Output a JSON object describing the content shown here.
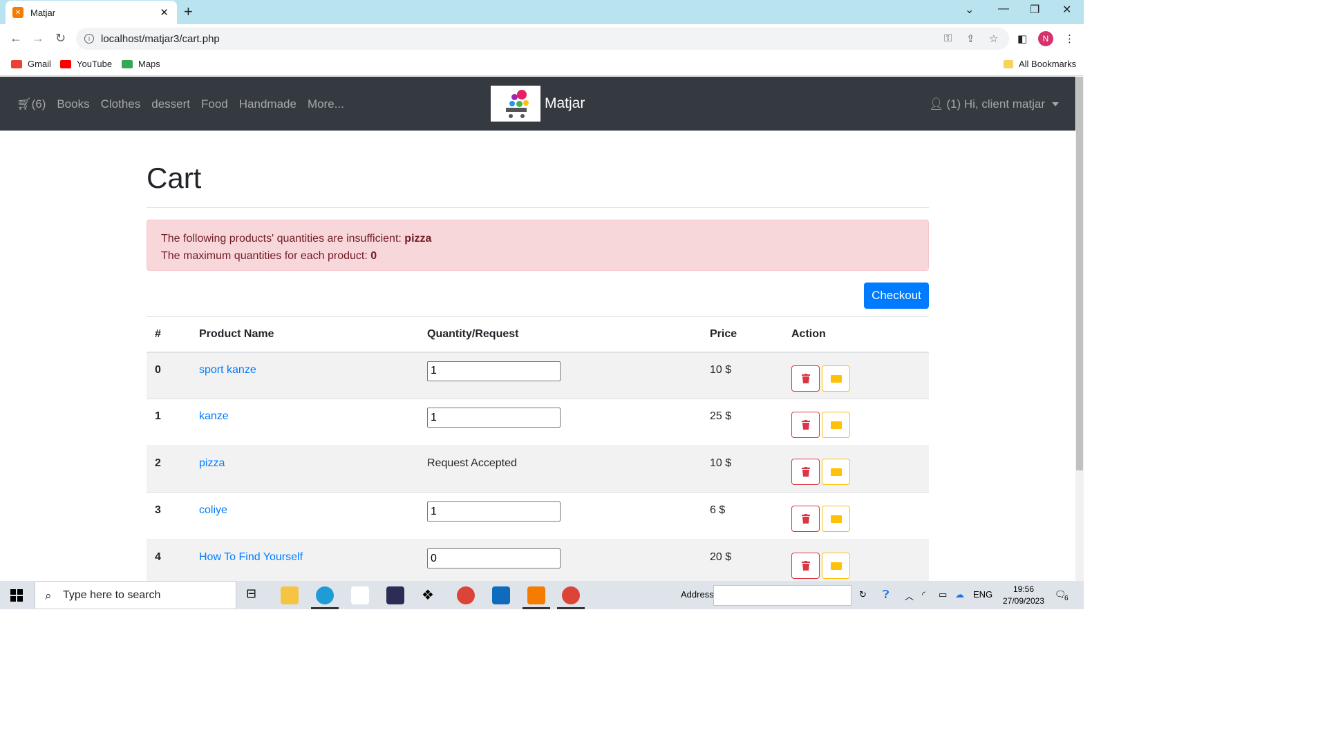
{
  "browser": {
    "tab_title": "Matjar",
    "url": "localhost/matjar3/cart.php",
    "profile_initial": "N",
    "bookmarks": [
      {
        "label": "Gmail",
        "color": "#ea4335"
      },
      {
        "label": "YouTube",
        "color": "#ff0000"
      },
      {
        "label": "Maps",
        "color": "#34a853"
      }
    ],
    "all_bookmarks": "All Bookmarks"
  },
  "navbar": {
    "cart_count": "(6)",
    "links": [
      "Books",
      "Clothes",
      "dessert",
      "Food",
      "Handmade",
      "More..."
    ],
    "brand": "Matjar",
    "user_label": "(1) Hi, client matjar"
  },
  "page": {
    "title": "Cart",
    "alert": {
      "line1_prefix": "The following products' quantities are insufficient: ",
      "line1_bold": "pizza",
      "line2_prefix": "The maximum quantities for each product: ",
      "line2_bold": "0"
    },
    "checkout_label": "Checkout"
  },
  "table": {
    "headers": [
      "#",
      "Product Name",
      "Quantity/Request",
      "Price",
      "Action"
    ],
    "rows": [
      {
        "num": "0",
        "name": "sport kanze",
        "qty": "1",
        "status": "",
        "price": "10 $"
      },
      {
        "num": "1",
        "name": "kanze",
        "qty": "1",
        "status": "",
        "price": "25 $"
      },
      {
        "num": "2",
        "name": "pizza",
        "qty": "",
        "status": "Request Accepted",
        "price": "10 $"
      },
      {
        "num": "3",
        "name": "coliye",
        "qty": "1",
        "status": "",
        "price": "6 $"
      },
      {
        "num": "4",
        "name": "How To Find Yourself",
        "qty": "0",
        "status": "",
        "price": "20 $"
      }
    ]
  },
  "taskbar": {
    "search_placeholder": "Type here to search",
    "address_label": "Address",
    "lang": "ENG",
    "time": "19:56",
    "date": "27/09/2023",
    "notif_count": "6"
  },
  "colors": {
    "navbar": "#343a40",
    "primary": "#007bff",
    "danger": "#dc3545",
    "warning": "#ffc107",
    "alert_bg": "#f8d7da"
  }
}
